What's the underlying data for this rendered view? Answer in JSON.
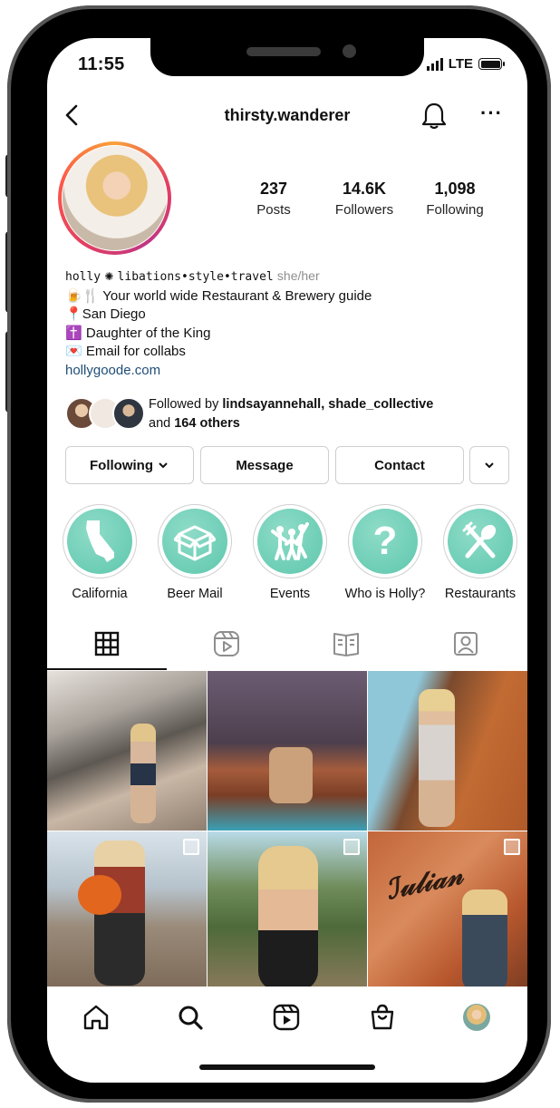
{
  "status_bar": {
    "time": "11:55",
    "network": "LTE"
  },
  "header": {
    "username": "thirsty.wanderer"
  },
  "stats": [
    {
      "value": "237",
      "label": "Posts"
    },
    {
      "value": "14.6K",
      "label": "Followers"
    },
    {
      "value": "1,098",
      "label": "Following"
    }
  ],
  "bio": {
    "name": "holly",
    "tagline": "libations•style•travel",
    "pronouns": "she/her",
    "lines": [
      {
        "emoji": "🍺🍴",
        "text": "Your world wide Restaurant & Brewery guide"
      },
      {
        "emoji": "📍",
        "text": "San Diego"
      },
      {
        "emoji": "✝️",
        "text": "Daughter of the King"
      },
      {
        "emoji": "💌",
        "text": "Email for collabs"
      }
    ],
    "link": "hollygoode.com"
  },
  "followed_by": {
    "prefix": "Followed by ",
    "names": "lindsayannehall, shade_collective",
    "and": "and ",
    "others": "164 others"
  },
  "actions": {
    "following": "Following",
    "message": "Message",
    "contact": "Contact"
  },
  "highlights": [
    {
      "label": "California",
      "icon": "california-icon"
    },
    {
      "label": "Beer Mail",
      "icon": "box-icon"
    },
    {
      "label": "Events",
      "icon": "people-celebrating-icon"
    },
    {
      "label": "Who is Holly?",
      "icon": "question-mark-icon"
    },
    {
      "label": "Restaurants",
      "icon": "fork-spoon-icon"
    }
  ],
  "tabs": [
    {
      "name": "grid",
      "icon": "grid-icon",
      "active": true
    },
    {
      "name": "reels",
      "icon": "reels-icon",
      "active": false
    },
    {
      "name": "guides",
      "icon": "guide-icon",
      "active": false
    },
    {
      "name": "tagged",
      "icon": "tagged-icon",
      "active": false
    }
  ],
  "colors": {
    "accent": "#5ec7ad",
    "link": "#1f4e79",
    "muted": "#8e8e8e"
  },
  "bottom_nav": [
    "home-icon",
    "search-icon",
    "reels-icon",
    "shop-icon",
    "profile-avatar"
  ]
}
